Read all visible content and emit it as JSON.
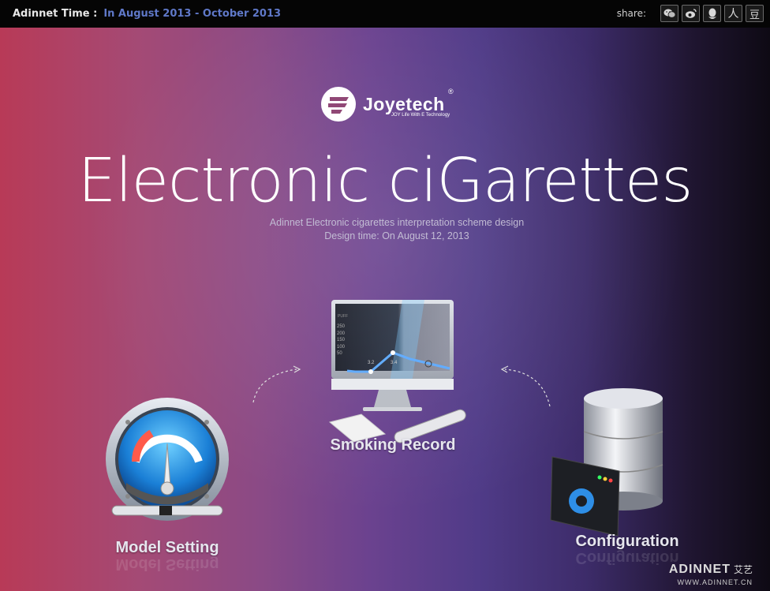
{
  "topbar": {
    "label": "Adinnet Time :",
    "range": "In August 2013 - October 2013",
    "share_label": "share:",
    "share_icons": [
      "wechat-icon",
      "weibo-icon",
      "qq-icon",
      "renren-icon",
      "douban-icon"
    ],
    "renren_char": "人",
    "douban_char": "豆"
  },
  "logo": {
    "brand": "Joyetech",
    "registered": "®",
    "tagline": "JOY Life With E Technology"
  },
  "hero": {
    "title": "Electronic ciGarettes",
    "subtitle1": "Adinnet Electronic cigarettes interpretation scheme design",
    "subtitle2": "Design time: On August 12, 2013"
  },
  "features": {
    "smoking_record": "Smoking Record",
    "model_setting": "Model Setting",
    "configuration": "Configuration",
    "chart_ticks": [
      "250",
      "200",
      "150",
      "100",
      "50"
    ],
    "chart_x_ticks": [
      "3.2",
      "3.4"
    ],
    "chart_unit": "PUFF"
  },
  "watermark": {
    "name": "ADINNET",
    "cn": "艾艺",
    "url": "WWW.ADINNET.CN"
  },
  "colors": {
    "accent_blue": "#5f78c8",
    "topbar_bg": "#050505"
  }
}
